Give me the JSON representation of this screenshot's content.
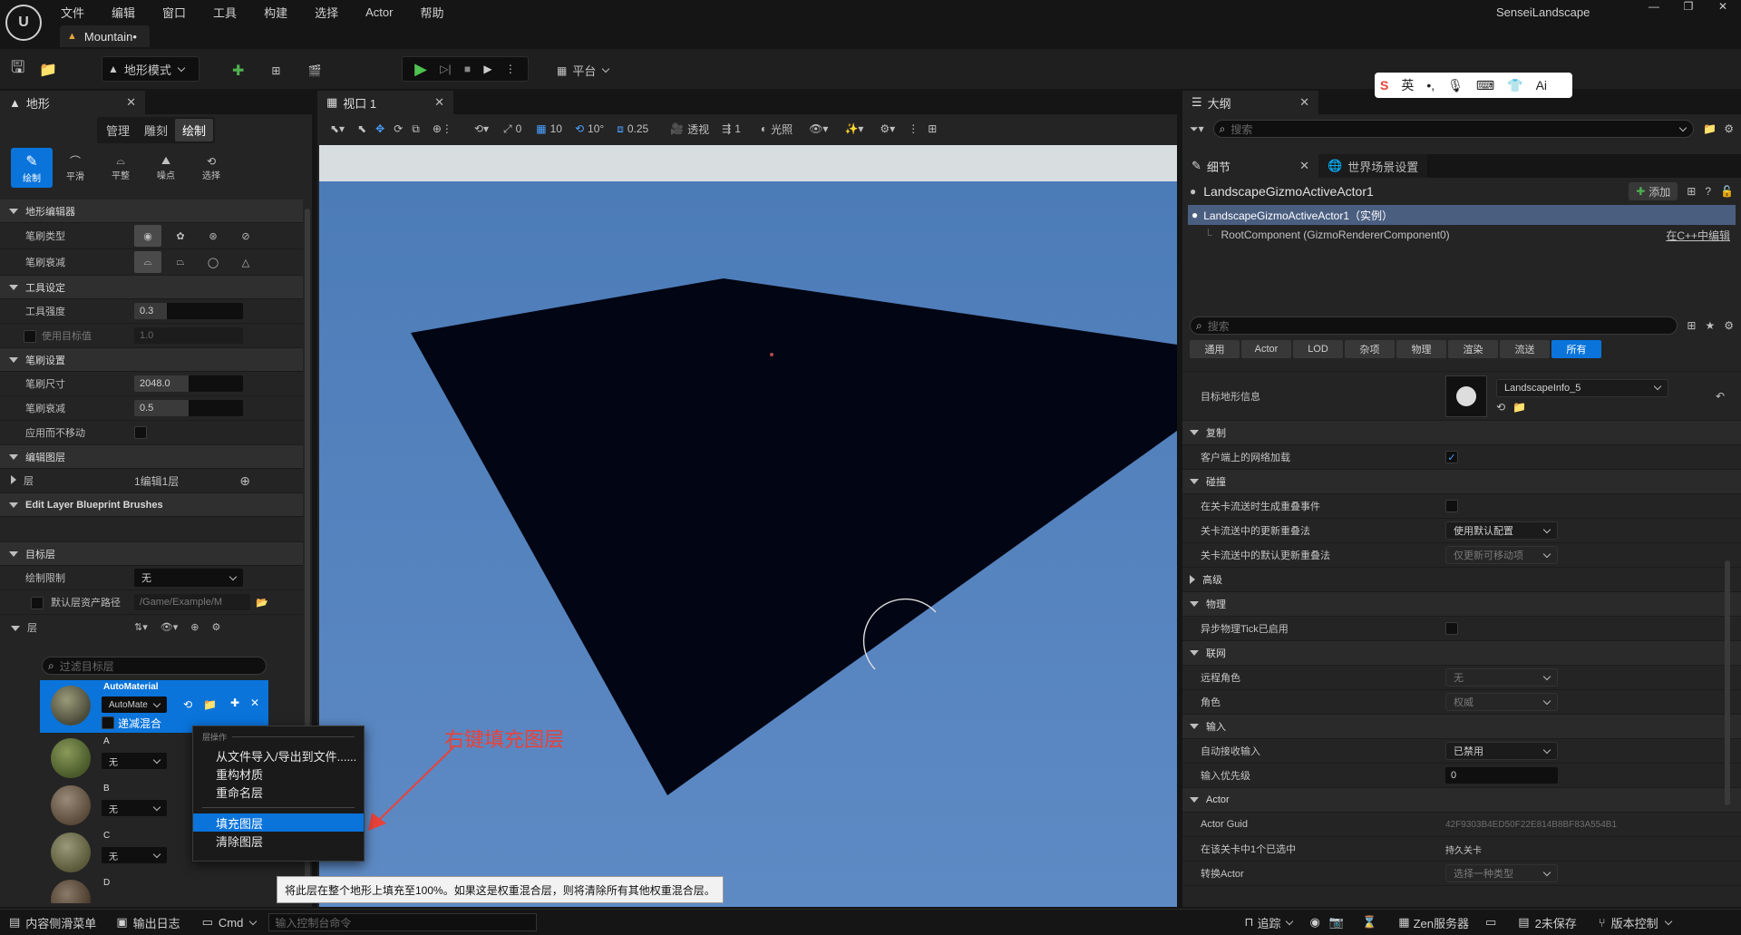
{
  "app": {
    "project_name": "SenseiLandscape",
    "doc_tab": "Mountain•",
    "menu": [
      "文件",
      "编辑",
      "窗口",
      "工具",
      "构建",
      "选择",
      "Actor",
      "帮助"
    ]
  },
  "toolbar": {
    "mode_label": "地形模式",
    "platform_label": "平台"
  },
  "left_panel": {
    "tab_title": "地形",
    "mode_tabs": [
      "管理",
      "雕刻",
      "绘制"
    ],
    "active_mode_tab": "绘制",
    "tools": [
      "绘制",
      "平滑",
      "平整",
      "噪点",
      "选择"
    ],
    "sections": {
      "editor": "地形编辑器",
      "tool_settings": "工具设定",
      "brush_settings": "笔刷设置",
      "edit_layers": "编辑图层",
      "blueprint_brushes": "Edit Layer Blueprint Brushes",
      "target_layers": "目标层"
    },
    "props": {
      "brush_type": "笔刷类型",
      "brush_falloff": "笔刷衰减",
      "tool_strength": "工具强度",
      "tool_strength_value": "0.3",
      "use_target": "使用目标值",
      "use_target_value": "1.0",
      "brush_size": "笔刷尺寸",
      "brush_size_value": "2048.0",
      "brush_falloff2": "笔刷衰减",
      "brush_falloff2_value": "0.5",
      "apply_static": "应用而不移动",
      "layers": "层",
      "layers_value": "1编辑1层",
      "paint_limit": "绘制限制",
      "paint_limit_value": "无",
      "default_path": "默认层资产路径",
      "default_path_value": "/Game/Example/M",
      "layer_label": "层"
    },
    "layer_filter_placeholder": "过滤目标层",
    "layer_list": [
      {
        "name": "AutoMaterial",
        "select": "AutoMate",
        "sub": "递减混合"
      },
      {
        "name": "A",
        "select": "无"
      },
      {
        "name": "B",
        "select": "无"
      },
      {
        "name": "C",
        "select": "无"
      },
      {
        "name": "D",
        "select": ""
      }
    ]
  },
  "context_menu": {
    "header": "层操作",
    "items": [
      "从文件导入/导出到文件......",
      "重构材质",
      "重命名层",
      "填充图层",
      "清除图层"
    ],
    "highlighted": "填充图层"
  },
  "tooltip": "将此层在整个地形上填充至100%。如果这是权重混合层，则将清除所有其他权重混合层。",
  "annotation": "右键填充图层",
  "viewport": {
    "tab_title": "视口 1",
    "grid_value": "10",
    "rot_value": "10°",
    "scale_value": "0.25",
    "view_mode": "透视",
    "lit_mode": "光照",
    "speed": "1",
    "zero_val": "0"
  },
  "outliner": {
    "tab_title": "大纲",
    "search_placeholder": "搜索"
  },
  "ime": [
    "英"
  ],
  "details": {
    "tab_details": "细节",
    "tab_world": "世界场景设置",
    "actor_name": "LandscapeGizmoActiveActor1",
    "add_button": "添加",
    "instance_label": "LandscapeGizmoActiveActor1（实例）",
    "root_component": "RootComponent (GizmoRendererComponent0)",
    "edit_in_cpp": "在C++中编辑",
    "search_placeholder": "搜索",
    "filters": [
      "通用",
      "Actor",
      "LOD",
      "杂项",
      "物理",
      "渲染",
      "流送",
      "所有"
    ],
    "active_filter": "所有",
    "target_info_label": "目标地形信息",
    "target_info_value": "LandscapeInfo_5",
    "sections": [
      {
        "type": "header",
        "label": "复制"
      },
      {
        "type": "check",
        "label": "客户端上的网络加载",
        "checked": true
      },
      {
        "type": "header",
        "label": "碰撞"
      },
      {
        "type": "check",
        "label": "在关卡流送时生成重叠事件",
        "checked": false
      },
      {
        "type": "dropdown",
        "label": "关卡流送中的更新重叠法",
        "value": "使用默认配置",
        "dim": false
      },
      {
        "type": "dropdown",
        "label": "关卡流送中的默认更新重叠法",
        "value": "仅更新可移动项",
        "dim": true
      },
      {
        "type": "collapsed",
        "label": "高级"
      },
      {
        "type": "header",
        "label": "物理"
      },
      {
        "type": "check",
        "label": "异步物理Tick已启用",
        "checked": false
      },
      {
        "type": "header",
        "label": "联网"
      },
      {
        "type": "dropdown",
        "label": "远程角色",
        "value": "无",
        "dim": true
      },
      {
        "type": "dropdown",
        "label": "角色",
        "value": "权威",
        "dim": true
      },
      {
        "type": "header",
        "label": "输入"
      },
      {
        "type": "dropdown",
        "label": "自动接收输入",
        "value": "已禁用",
        "dim": false
      },
      {
        "type": "input",
        "label": "输入优先级",
        "value": "0"
      },
      {
        "type": "header",
        "label": "Actor"
      },
      {
        "type": "text",
        "label": "Actor Guid",
        "value": "42F9303B4ED50F22E814B8BF83A554B1",
        "dim": true
      },
      {
        "type": "text",
        "label": "在该关卡中1个已选中",
        "value": "持久关卡",
        "dim": false
      },
      {
        "type": "dropdown",
        "label": "转换Actor",
        "value": "选择一种类型",
        "dim": true
      }
    ]
  },
  "statusbar": {
    "content_drawer": "内容侧滑菜单",
    "output_log": "输出日志",
    "cmd": "Cmd",
    "console_placeholder": "输入控制台命令",
    "trace": "追踪",
    "zen": "Zen服务器",
    "unsaved": "2未保存",
    "version_control": "版本控制"
  }
}
